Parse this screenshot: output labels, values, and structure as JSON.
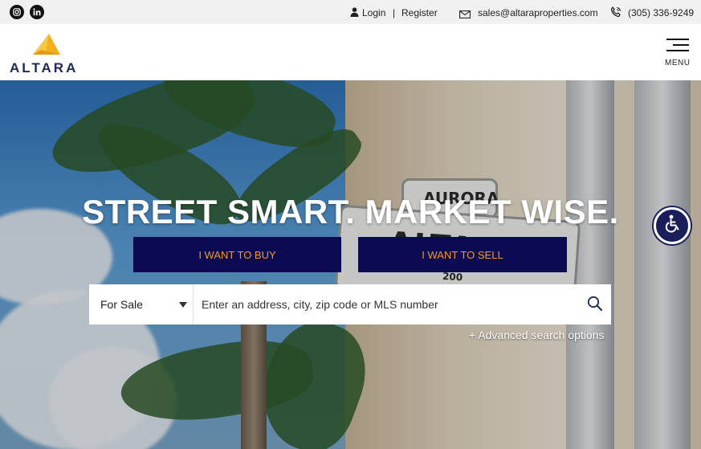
{
  "topbar": {
    "social": [
      "instagram-icon",
      "linkedin-icon"
    ],
    "login": "Login",
    "separator": "|",
    "register": "Register",
    "email": "sales@altaraproperties.com",
    "phone": "(305) 336-9249"
  },
  "header": {
    "logo_text": "ALTARA",
    "menu_label": "MENU"
  },
  "hero": {
    "sign_top": "AURORA",
    "sign_main": "ALTARA",
    "sign_number": "200",
    "headline": "STREET SMART. MARKET WISE.",
    "buy_label": "I WANT TO BUY",
    "sell_label": "I WANT TO SELL",
    "search": {
      "type_selected": "For Sale",
      "placeholder": "Enter an address, city, zip code or MLS number"
    },
    "advanced_label": "+ Advanced search options"
  },
  "colors": {
    "brand_navy": "#0c0a52",
    "cta_text": "#f39a1f",
    "logo_gold": "#f2b01e",
    "logo_text": "#1b2a57"
  }
}
